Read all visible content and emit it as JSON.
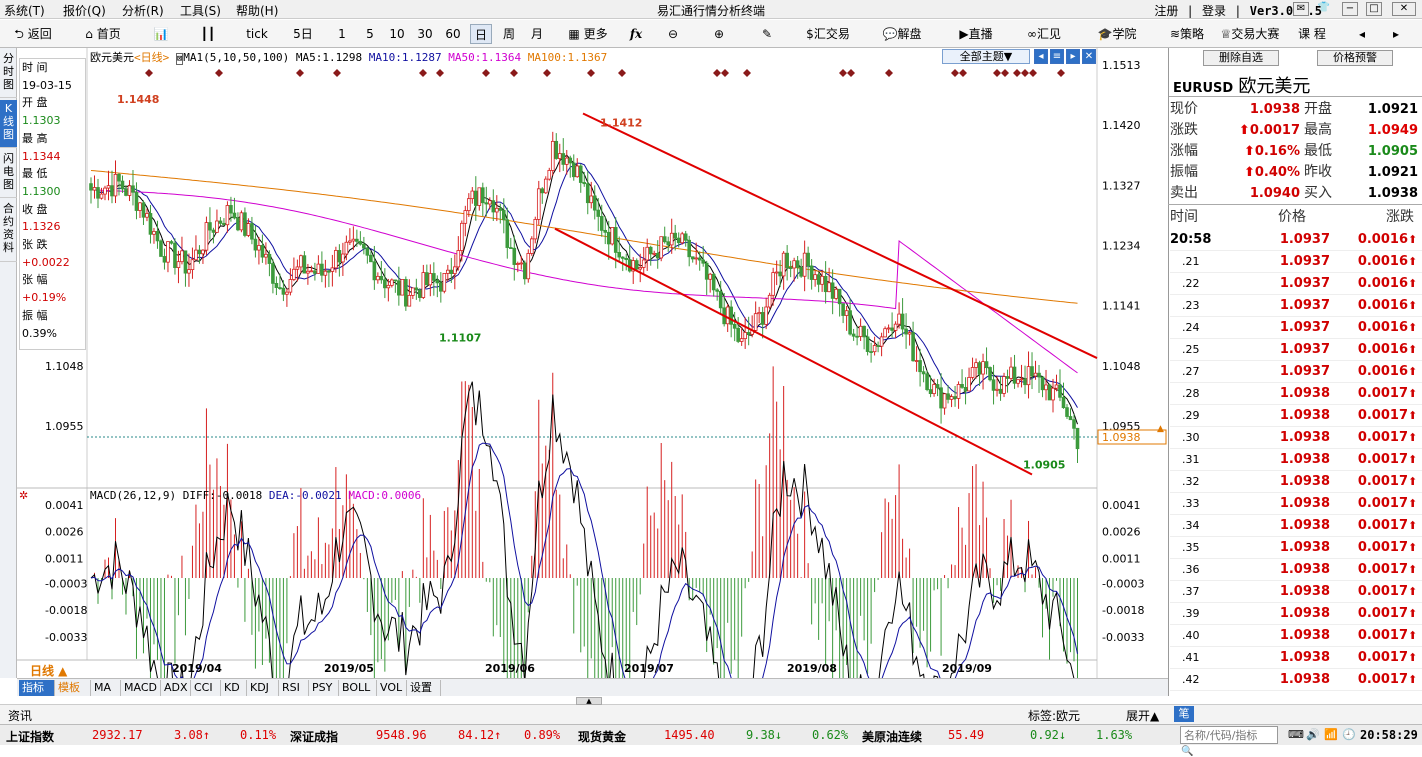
{
  "menu": [
    "系统(T)",
    "报价(Q)",
    "分析(R)",
    "工具(S)",
    "帮助(H)"
  ],
  "app_title": "易汇通行情分析终端",
  "account": {
    "register": "注册",
    "login": "登录",
    "version": "Ver3.0.4.5"
  },
  "toolbar": {
    "back": "返回",
    "home": "首页",
    "tick": "tick",
    "periods": [
      "5日",
      "1",
      "5",
      "10",
      "30",
      "60",
      "日",
      "周",
      "月"
    ],
    "more": "更多",
    "fx": "fx",
    "trade": "汇交易",
    "analysis": "解盘",
    "live": "直播",
    "view": "汇见",
    "academy": "学院",
    "strategy": "策略",
    "contest": "交易大赛",
    "course": "课 程"
  },
  "left_tabs": [
    "分时图",
    "K线图",
    "闪电图",
    "合约资料"
  ],
  "chart": {
    "symbol_title": "欧元美元",
    "period_tag": "<日线>",
    "ma_legend": {
      "label": "MA1(5,10,50,100)",
      "ma5": "MA5:1.1298",
      "ma10": "MA10:1.1287",
      "ma50": "MA50:1.1364",
      "ma100": "MA100:1.1367"
    },
    "theme_select": "全部主题▼",
    "price_labels": [
      "1.1513",
      "1.1420",
      "1.1327",
      "1.1234",
      "1.1141",
      "1.1048",
      "1.0955"
    ],
    "left_price_labels": [
      "1.1048",
      "1.0955"
    ],
    "current_price_label": "1.0938",
    "annotations": {
      "high": "1.1448",
      "mid_high": "1.1412",
      "low": "1.1107",
      "last_low": "1.0905"
    },
    "macd_legend": {
      "label": "MACD(26,12,9)",
      "diff": "DIFF:-0.0018",
      "dea": "DEA:-0.0021",
      "macd": "MACD:0.0006"
    },
    "macd_labels": [
      "0.0041",
      "0.0026",
      "0.0011",
      "-0.0003",
      "-0.0018",
      "-0.0033"
    ],
    "date_labels": [
      "2019/04",
      "2019/05",
      "2019/06",
      "2019/07",
      "2019/08",
      "2019/09"
    ],
    "period_bottom": "日线 ▲",
    "colors": {
      "up": "#d62020",
      "down": "#3c9a3c",
      "ma5": "#000000",
      "ma10": "#1010a0",
      "ma50": "#d000d0",
      "ma100": "#e07800",
      "channel": "#e00000"
    }
  },
  "info_box": [
    {
      "label": "时 间",
      "value": "19-03-15",
      "color": "black"
    },
    {
      "label": "开 盘",
      "value": "1.1303",
      "color": "green"
    },
    {
      "label": "最 高",
      "value": "1.1344",
      "color": "red"
    },
    {
      "label": "最 低",
      "value": "1.1300",
      "color": "green"
    },
    {
      "label": "收 盘",
      "value": "1.1326",
      "color": "red"
    },
    {
      "label": "张 跌",
      "value": "+0.0022",
      "color": "red"
    },
    {
      "label": "张 幅",
      "value": "+0.19%",
      "color": "red"
    },
    {
      "label": "振 幅",
      "value": "0.39%",
      "color": "black"
    }
  ],
  "indicator_tabs": [
    "指标",
    "模板",
    "MA",
    "MACD",
    "ADX",
    "CCI",
    "KD",
    "KDJ",
    "RSI",
    "PSY",
    "BOLL",
    "VOL",
    "设置"
  ],
  "right_panel": {
    "btn_remove": "删除自选",
    "btn_alert": "价格预警",
    "code": "EURUSD",
    "name": "欧元美元",
    "quotes": [
      {
        "l1": "现价",
        "v1": "1.0938",
        "l2": "开盘",
        "v2": "1.0921"
      },
      {
        "l1": "涨跌",
        "v1": "0.0017",
        "l2": "最高",
        "v2": "1.0949"
      },
      {
        "l1": "涨幅",
        "v1": "0.16%",
        "l2": "最低",
        "v2": "1.0905"
      },
      {
        "l1": "振幅",
        "v1": "0.40%",
        "l2": "昨收",
        "v2": "1.0921"
      },
      {
        "l1": "卖出",
        "v1": "1.0940",
        "l2": "买入",
        "v2": "1.0938"
      }
    ],
    "tick_header": [
      "时间",
      "价格",
      "涨跌"
    ],
    "ticks": [
      {
        "t": "20:58",
        "p": "1.0937",
        "c": "0.0016"
      },
      {
        "t": ".21",
        "p": "1.0937",
        "c": "0.0016"
      },
      {
        "t": ".22",
        "p": "1.0937",
        "c": "0.0016"
      },
      {
        "t": ".23",
        "p": "1.0937",
        "c": "0.0016"
      },
      {
        "t": ".24",
        "p": "1.0937",
        "c": "0.0016"
      },
      {
        "t": ".25",
        "p": "1.0937",
        "c": "0.0016"
      },
      {
        "t": ".27",
        "p": "1.0937",
        "c": "0.0016"
      },
      {
        "t": ".28",
        "p": "1.0938",
        "c": "0.0017"
      },
      {
        "t": ".29",
        "p": "1.0938",
        "c": "0.0017"
      },
      {
        "t": ".30",
        "p": "1.0938",
        "c": "0.0017"
      },
      {
        "t": ".31",
        "p": "1.0938",
        "c": "0.0017"
      },
      {
        "t": ".32",
        "p": "1.0938",
        "c": "0.0017"
      },
      {
        "t": ".33",
        "p": "1.0938",
        "c": "0.0017"
      },
      {
        "t": ".34",
        "p": "1.0938",
        "c": "0.0017"
      },
      {
        "t": ".35",
        "p": "1.0938",
        "c": "0.0017"
      },
      {
        "t": ".36",
        "p": "1.0938",
        "c": "0.0017"
      },
      {
        "t": ".37",
        "p": "1.0938",
        "c": "0.0017"
      },
      {
        "t": ".39",
        "p": "1.0938",
        "c": "0.0017"
      },
      {
        "t": ".40",
        "p": "1.0938",
        "c": "0.0017"
      },
      {
        "t": ".41",
        "p": "1.0938",
        "c": "0.0017"
      },
      {
        "t": ".42",
        "p": "1.0938",
        "c": "0.0017"
      }
    ]
  },
  "info_strip": {
    "news": "资讯",
    "tag": "标签:欧元",
    "expand": "展开▲",
    "pen": "笔"
  },
  "status": {
    "items": [
      {
        "name": "上证指数",
        "value": "2932.17",
        "change": "3.08↑",
        "pct": "0.11%",
        "dir": "up"
      },
      {
        "name": "深证成指",
        "value": "9548.96",
        "change": "84.12↑",
        "pct": "0.89%",
        "dir": "up"
      },
      {
        "name": "现货黄金",
        "value": "1495.40",
        "change": "9.38↓",
        "pct": "0.62%",
        "dir": "down"
      },
      {
        "name": "美原油连续",
        "value": "55.49",
        "change": "0.92↓",
        "pct": "1.63%",
        "dir": "down"
      }
    ],
    "search_placeholder": "名称/代码/指标",
    "time": "20:58:29"
  }
}
